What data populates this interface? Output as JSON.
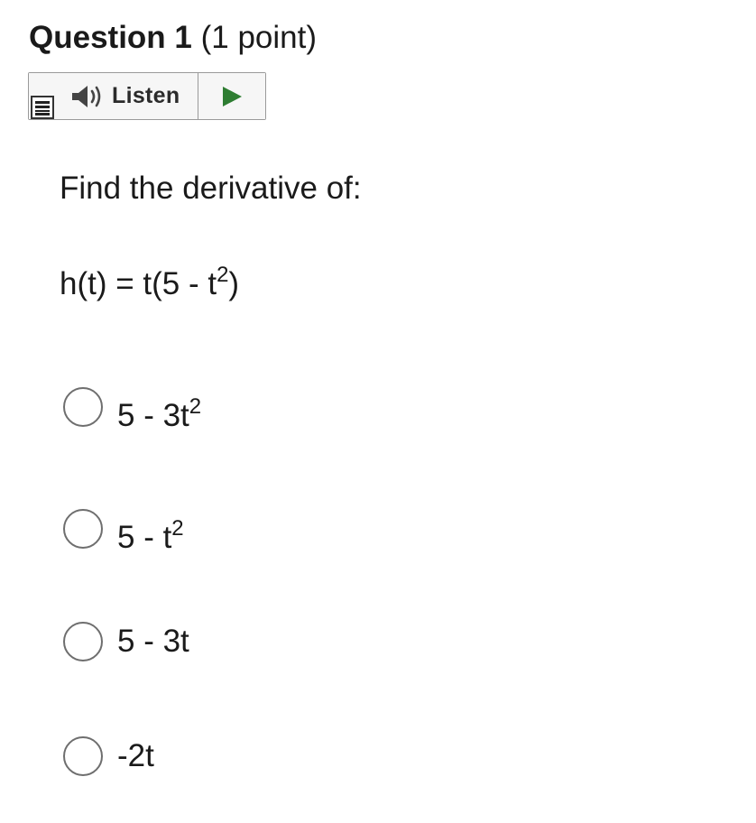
{
  "question": {
    "title": "Question 1",
    "points": "(1 point)",
    "prompt": "Find the derivative of:",
    "function_base": "h(t) = t(5 - t",
    "function_exponent": "2",
    "function_close": ")"
  },
  "listen_widget": {
    "label": "Listen",
    "speaker_icon": "speaker-icon",
    "play_icon": "play-icon",
    "menu_icon": "menu-icon",
    "play_color": "#2e7d32"
  },
  "options": [
    {
      "base": "5 - 3t",
      "exponent": "2"
    },
    {
      "base": "5 - t",
      "exponent": "2"
    },
    {
      "base": "5 - 3t",
      "exponent": ""
    },
    {
      "base": "-2t",
      "exponent": ""
    }
  ]
}
